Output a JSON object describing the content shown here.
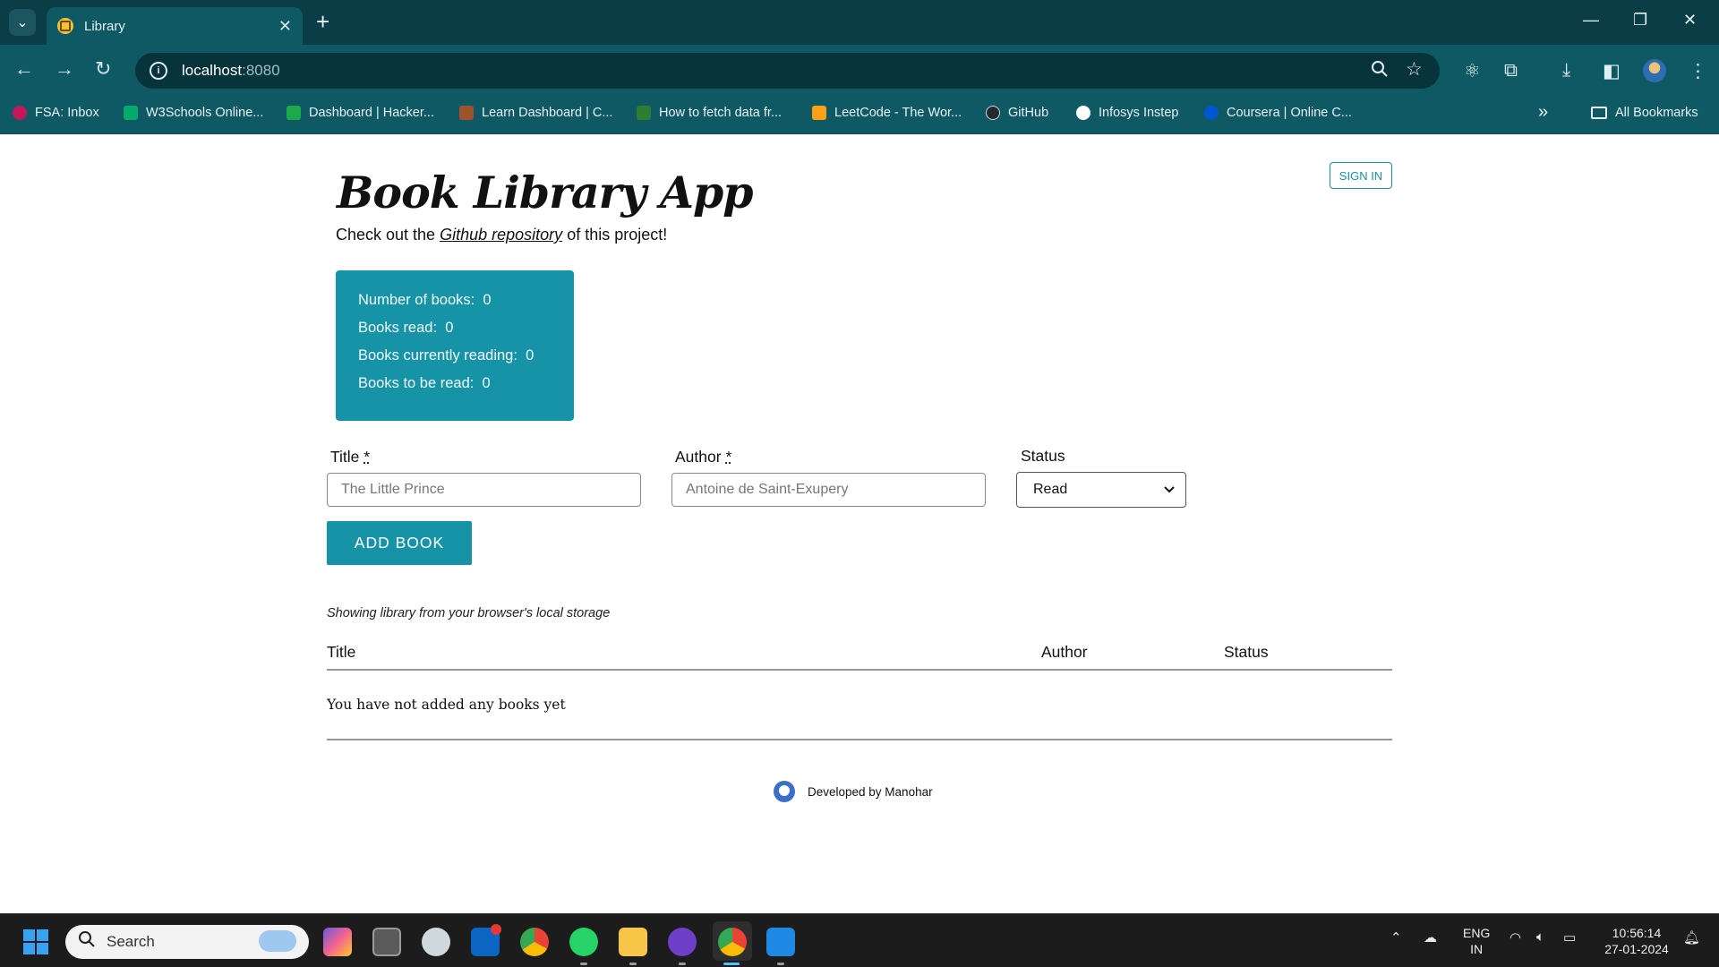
{
  "browser": {
    "tab": {
      "title": "Library",
      "close": "✕"
    },
    "new_tab": "+",
    "url": {
      "host": "localhost",
      "port": ":8080"
    },
    "window_controls": {
      "minimize": "—",
      "restore": "❐",
      "close": "✕"
    },
    "nav": {
      "back": "←",
      "forward": "→",
      "reload": "↻"
    },
    "bookmarks": [
      {
        "label": "FSA: Inbox",
        "color": "#c2185b"
      },
      {
        "label": "W3Schools Online...",
        "color": "#04aa6d"
      },
      {
        "label": "Dashboard | Hacker...",
        "color": "#1ba94c"
      },
      {
        "label": "Learn Dashboard | C...",
        "color": "#a0522d"
      },
      {
        "label": "How to fetch data fr...",
        "color": "#2e7d32"
      },
      {
        "label": "LeetCode - The Wor...",
        "color": "#ffa116"
      },
      {
        "label": "GitHub",
        "color": "#24292f"
      },
      {
        "label": "Infosys Instep",
        "color": "#ffffff"
      },
      {
        "label": "Coursera | Online C...",
        "color": "#0056d2"
      }
    ],
    "bookmarks_overflow": "»",
    "all_bookmarks": "All Bookmarks"
  },
  "app": {
    "signin_label": "SIGN IN",
    "title": "Book Library App",
    "subtitle_prefix": "Check out the",
    "subtitle_link": "Github repository",
    "subtitle_suffix": "of this project!",
    "stats": {
      "total_label": "Number of books:",
      "total_value": "0",
      "read_label": "Books read:",
      "read_value": "0",
      "reading_label": "Books currently reading:",
      "reading_value": "0",
      "toread_label": "Books to be read:",
      "toread_value": "0"
    },
    "form": {
      "title_label": "Title",
      "title_placeholder": "The Little Prince",
      "author_label": "Author",
      "author_placeholder": "Antoine de Saint-Exupery",
      "required_mark": "*",
      "status_label": "Status",
      "status_value": "Read",
      "add_button": "ADD BOOK"
    },
    "storage_note": "Showing library from your browser's local storage",
    "table": {
      "headers": [
        "Title",
        "Author",
        "Status"
      ],
      "empty_message": "You have not added any books yet"
    },
    "footer": "Developed by Manohar"
  },
  "taskbar": {
    "search_label": "Search",
    "language": {
      "line1": "ENG",
      "line2": "IN"
    },
    "time": "10:56:14",
    "date": "27-01-2024"
  }
}
